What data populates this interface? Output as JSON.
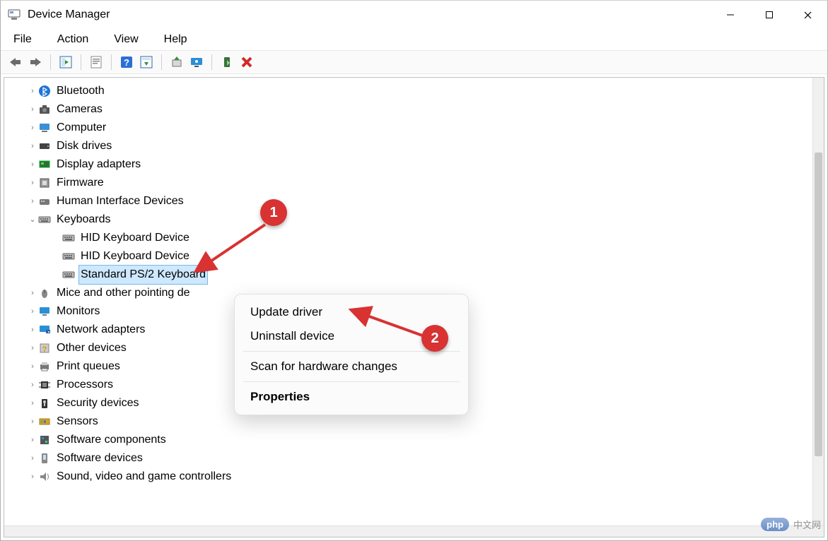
{
  "window": {
    "title": "Device Manager"
  },
  "menu": {
    "file": "File",
    "action": "Action",
    "view": "View",
    "help": "Help"
  },
  "toolbar_icons": {
    "back": "back-arrow",
    "forward": "forward-arrow",
    "show_hide": "show-hide-tree",
    "refresh": "refresh",
    "help": "help",
    "properties": "properties",
    "update": "update-driver",
    "monitor": "monitor-scan",
    "enable": "enable-device",
    "remove": "remove-device"
  },
  "tree": [
    {
      "label": "Bluetooth",
      "icon": "bluetooth",
      "expandable": true,
      "expanded": false,
      "level": 0
    },
    {
      "label": "Cameras",
      "icon": "camera",
      "expandable": true,
      "expanded": false,
      "level": 0
    },
    {
      "label": "Computer",
      "icon": "computer",
      "expandable": true,
      "expanded": false,
      "level": 0
    },
    {
      "label": "Disk drives",
      "icon": "disk",
      "expandable": true,
      "expanded": false,
      "level": 0
    },
    {
      "label": "Display adapters",
      "icon": "display-adapter",
      "expandable": true,
      "expanded": false,
      "level": 0
    },
    {
      "label": "Firmware",
      "icon": "firmware",
      "expandable": true,
      "expanded": false,
      "level": 0
    },
    {
      "label": "Human Interface Devices",
      "icon": "hid",
      "expandable": true,
      "expanded": false,
      "level": 0
    },
    {
      "label": "Keyboards",
      "icon": "keyboard",
      "expandable": true,
      "expanded": true,
      "level": 0
    },
    {
      "label": "HID Keyboard Device",
      "icon": "keyboard",
      "expandable": false,
      "level": 1
    },
    {
      "label": "HID Keyboard Device",
      "icon": "keyboard",
      "expandable": false,
      "level": 1
    },
    {
      "label": "Standard PS/2 Keyboard",
      "icon": "keyboard",
      "expandable": false,
      "level": 1,
      "selected": true
    },
    {
      "label": "Mice and other pointing devices",
      "icon": "mouse",
      "expandable": true,
      "expanded": false,
      "level": 0,
      "truncated": "Mice and other pointing de"
    },
    {
      "label": "Monitors",
      "icon": "monitor",
      "expandable": true,
      "expanded": false,
      "level": 0
    },
    {
      "label": "Network adapters",
      "icon": "network",
      "expandable": true,
      "expanded": false,
      "level": 0
    },
    {
      "label": "Other devices",
      "icon": "unknown",
      "expandable": true,
      "expanded": false,
      "level": 0
    },
    {
      "label": "Print queues",
      "icon": "printer",
      "expandable": true,
      "expanded": false,
      "level": 0
    },
    {
      "label": "Processors",
      "icon": "cpu",
      "expandable": true,
      "expanded": false,
      "level": 0
    },
    {
      "label": "Security devices",
      "icon": "security",
      "expandable": true,
      "expanded": false,
      "level": 0
    },
    {
      "label": "Sensors",
      "icon": "sensor",
      "expandable": true,
      "expanded": false,
      "level": 0
    },
    {
      "label": "Software components",
      "icon": "software-component",
      "expandable": true,
      "expanded": false,
      "level": 0
    },
    {
      "label": "Software devices",
      "icon": "software-device",
      "expandable": true,
      "expanded": false,
      "level": 0
    },
    {
      "label": "Sound, video and game controllers",
      "icon": "sound",
      "expandable": true,
      "expanded": false,
      "level": 0
    }
  ],
  "context_menu": {
    "update": "Update driver",
    "uninstall": "Uninstall device",
    "scan": "Scan for hardware changes",
    "properties": "Properties"
  },
  "callouts": {
    "c1": "1",
    "c2": "2"
  },
  "watermark": {
    "logo": "php",
    "text": "中文网"
  }
}
